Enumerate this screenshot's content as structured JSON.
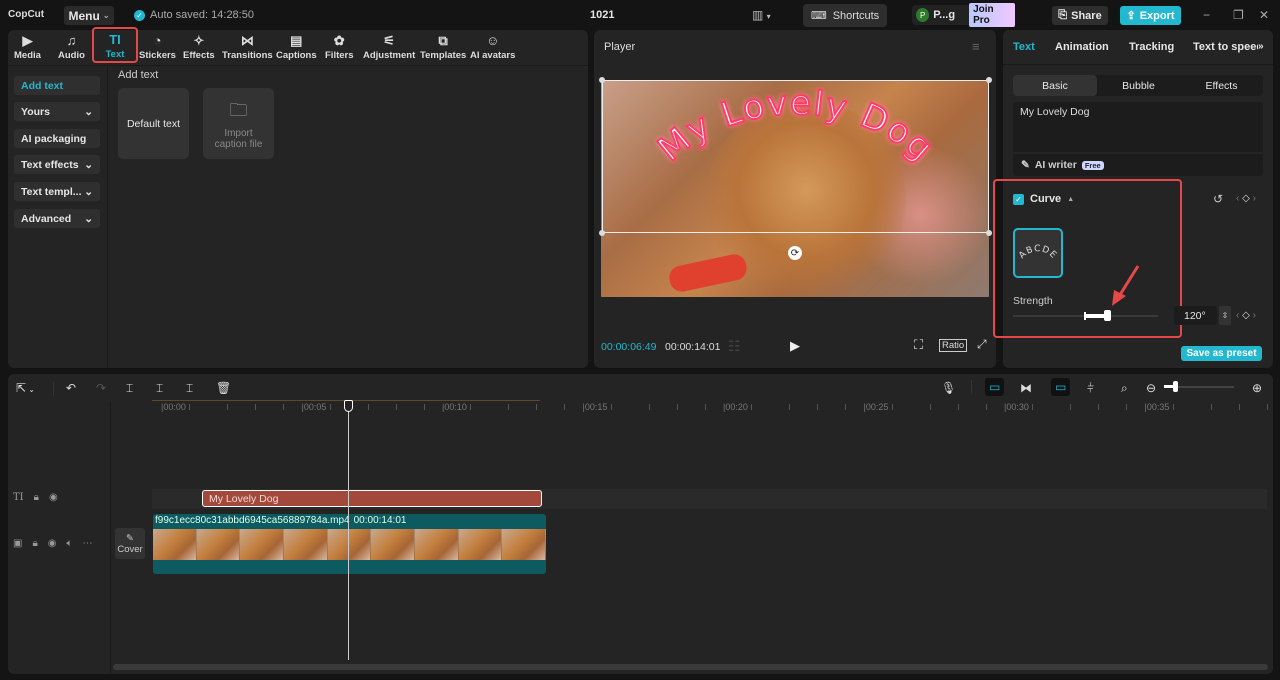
{
  "app": {
    "logo": "CopCut",
    "menu_label": "Menu",
    "autosave": "Auto saved: 14:28:50",
    "project_title": "1021"
  },
  "topbar": {
    "shortcuts_label": "Shortcuts",
    "user_initial": "P",
    "user_name": "P...g",
    "join_pro_label": "Join Pro",
    "share_label": "Share",
    "export_label": "Export",
    "window_controls": [
      "−",
      "❐",
      "✕"
    ]
  },
  "tools": [
    {
      "label": "Media",
      "icon": "▶"
    },
    {
      "label": "Audio",
      "icon": "♫"
    },
    {
      "label": "Text",
      "icon": "TI",
      "active": true
    },
    {
      "label": "Stickers",
      "icon": "◔"
    },
    {
      "label": "Effects",
      "icon": "✧"
    },
    {
      "label": "Transitions",
      "icon": "⋈"
    },
    {
      "label": "Captions",
      "icon": "▤"
    },
    {
      "label": "Filters",
      "icon": "✿"
    },
    {
      "label": "Adjustment",
      "icon": "⚟"
    },
    {
      "label": "Templates",
      "icon": "⧉"
    },
    {
      "label": "AI avatars",
      "icon": "☺"
    }
  ],
  "text_sidebar": [
    {
      "label": "Add text",
      "active": true,
      "chevron": ""
    },
    {
      "label": "Yours",
      "chevron": "⌄"
    },
    {
      "label": "AI packaging",
      "chevron": ""
    },
    {
      "label": "Text effects",
      "chevron": "⌄"
    },
    {
      "label": "Text templ...",
      "chevron": "⌄"
    },
    {
      "label": "Advanced",
      "chevron": "⌄"
    }
  ],
  "add_text": {
    "heading": "Add text",
    "default_card": "Default text",
    "import_card": "Import caption file"
  },
  "player": {
    "title": "Player",
    "overlay_text": "My Lovely Dog",
    "current_time": "00:00:06:49",
    "total_time": "00:00:14:01",
    "ratio_label": "Ratio"
  },
  "inspector": {
    "tabs": [
      "Text",
      "Animation",
      "Tracking",
      "Text to speech"
    ],
    "active_tab": "Text",
    "subtabs": [
      "Basic",
      "Bubble",
      "Effects"
    ],
    "active_subtab": "Basic",
    "text_value": "My Lovely Dog",
    "ai_writer_label": "AI writer",
    "free_badge": "Free",
    "curve": {
      "label": "Curve",
      "enabled": true,
      "preview_text": "ABCDE",
      "strength_label": "Strength",
      "strength_value": "120°",
      "strength_fraction": 0.65
    },
    "save_preset_label": "Save as preset"
  },
  "timeline": {
    "ruler_labels": [
      "00:00",
      "00:05",
      "00:10",
      "00:15",
      "00:20",
      "00:25",
      "00:30",
      "00:35"
    ],
    "playhead_time": "00:00:06:49",
    "text_clip_label": "My Lovely Dog",
    "video_clip_name": "f99c1ecc80c31abbd6945ca56889784a.mp4",
    "video_clip_duration": "00:00:14:01",
    "cover_label": "Cover",
    "zoom_fraction": 0.15
  },
  "colors": {
    "accent": "#22b8cf",
    "highlight": "#e54848",
    "text_clip": "#a2493c",
    "video_clip": "#0d5a60"
  }
}
